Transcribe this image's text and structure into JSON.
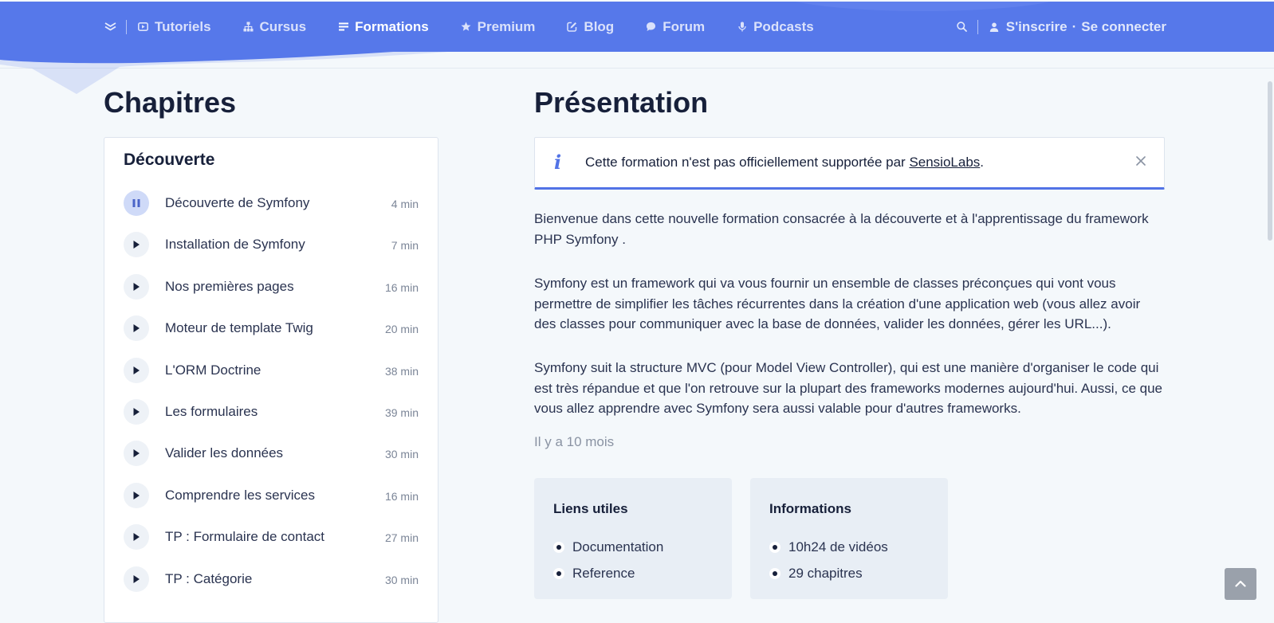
{
  "nav": {
    "items": [
      {
        "label": "Tutoriels",
        "icon": "play-square-icon",
        "active": false
      },
      {
        "label": "Cursus",
        "icon": "hierarchy-icon",
        "active": false
      },
      {
        "label": "Formations",
        "icon": "list-icon",
        "active": true
      },
      {
        "label": "Premium",
        "icon": "star-icon",
        "active": false
      },
      {
        "label": "Blog",
        "icon": "edit-icon",
        "active": false
      },
      {
        "label": "Forum",
        "icon": "chat-bubble-icon",
        "active": false
      },
      {
        "label": "Podcasts",
        "icon": "microphone-icon",
        "active": false
      }
    ],
    "signup_label": "S'inscrire",
    "separator": "·",
    "login_label": "Se connecter"
  },
  "chapters": {
    "heading": "Chapitres",
    "section_title": "Découverte",
    "items": [
      {
        "title": "Découverte de Symfony",
        "duration": "4 min",
        "current": true
      },
      {
        "title": "Installation de Symfony",
        "duration": "7 min"
      },
      {
        "title": "Nos premières pages",
        "duration": "16 min"
      },
      {
        "title": "Moteur de template Twig",
        "duration": "20 min"
      },
      {
        "title": "L'ORM Doctrine",
        "duration": "38 min"
      },
      {
        "title": "Les formulaires",
        "duration": "39 min"
      },
      {
        "title": "Valider les données",
        "duration": "30 min"
      },
      {
        "title": "Comprendre les services",
        "duration": "16 min"
      },
      {
        "title": "TP : Formulaire de contact",
        "duration": "27 min"
      },
      {
        "title": "TP : Catégorie",
        "duration": "30 min"
      }
    ]
  },
  "presentation": {
    "heading": "Présentation",
    "notice": {
      "text_before": "Cette formation n'est pas officiellement supportée par ",
      "link": "SensioLabs",
      "text_after": "."
    },
    "paragraphs": [
      "Bienvenue dans cette nouvelle formation consacrée à la découverte et à l'apprentissage du framework PHP Symfony .",
      "Symfony est un framework qui va vous fournir un ensemble de classes préconçues qui vont vous permettre de simplifier les tâches récurrentes dans la création d'une application web (vous allez avoir des classes pour communiquer avec la base de données, valider les données, gérer les URL...).",
      "Symfony suit la structure MVC (pour Model View Controller), qui est une manière d'organiser le code qui est très répandue et que l'on retrouve sur la plupart des frameworks modernes aujourd'hui. Aussi, ce que vous allez apprendre avec Symfony sera aussi valable pour d'autres frameworks."
    ],
    "date": "Il y a 10 mois",
    "useful_links": {
      "title": "Liens utiles",
      "items": [
        "Documentation",
        "Reference"
      ]
    },
    "information": {
      "title": "Informations",
      "items": [
        "10h24 de vidéos",
        "29 chapitres"
      ]
    }
  },
  "colors": {
    "nav_background": "#5678ea",
    "accent": "#5273e6",
    "text_dark": "#17203a",
    "page_background": "#f4f8fb"
  }
}
